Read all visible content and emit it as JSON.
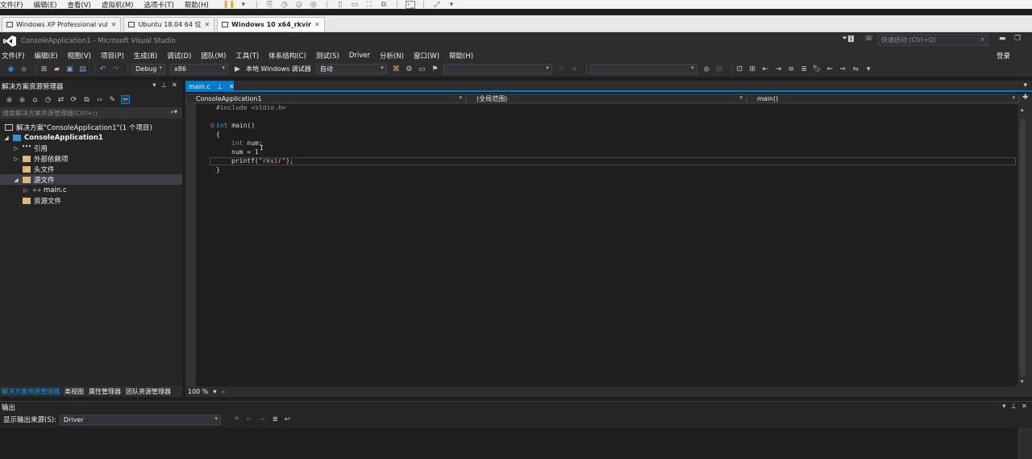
{
  "vmware": {
    "menu": [
      "文件(F)",
      "编辑(E)",
      "查看(V)",
      "虚拟机(M)",
      "选项卡(T)",
      "帮助(H)"
    ],
    "tabs": [
      {
        "label": "Windows XP Professional vul",
        "active": false
      },
      {
        "label": "Ubuntu 18.04 64 位",
        "active": false
      },
      {
        "label": "Windows 10 x64_rkvir",
        "active": true
      }
    ]
  },
  "vs": {
    "title": "ConsoleApplication1 - Microsoft Visual Studio",
    "quick_launch_placeholder": "快速启动 (Ctrl+Q)",
    "notification_count": "1",
    "menu": [
      "文件(F)",
      "编辑(E)",
      "视图(V)",
      "项目(P)",
      "生成(B)",
      "调试(D)",
      "团队(M)",
      "工具(T)",
      "体系结构(C)",
      "测试(S)",
      "Driver",
      "分析(N)",
      "窗口(W)",
      "帮助(H)"
    ],
    "login_label": "登录",
    "toolbar": {
      "config": "Debug",
      "platform": "x86",
      "debug_target": "本地 Windows 调试器",
      "debug_mode": "自动"
    },
    "solution_explorer": {
      "title": "解决方案资源管理器",
      "search_placeholder": "搜索解决方案资源管理器(Ctrl+;)",
      "tree": [
        {
          "label": "解决方案\"ConsoleApplication1\"(1 个项目)",
          "depth": 0,
          "arrow": "",
          "bold": false
        },
        {
          "label": "ConsoleApplication1",
          "depth": 1,
          "arrow": "◢",
          "bold": true
        },
        {
          "label": "引用",
          "depth": 2,
          "arrow": "▷",
          "bold": false
        },
        {
          "label": "外部依赖项",
          "depth": 2,
          "arrow": "▷",
          "bold": false
        },
        {
          "label": "头文件",
          "depth": 2,
          "arrow": "",
          "bold": false
        },
        {
          "label": "源文件",
          "depth": 2,
          "arrow": "◢",
          "bold": false
        },
        {
          "label": "main.c",
          "depth": 3,
          "arrow": "▷",
          "bold": false
        },
        {
          "label": "资源文件",
          "depth": 2,
          "arrow": "",
          "bold": false
        }
      ],
      "bottom_tabs": [
        "解决方案资源管理器",
        "类视图",
        "属性管理器",
        "团队资源管理器"
      ]
    },
    "editor": {
      "tab_label": "main.c",
      "nav_project": "ConsoleApplication1",
      "nav_scope": "(全局范围)",
      "nav_member": "main()",
      "zoom": "100 %",
      "code": {
        "include": "#include <stdio.h>",
        "main_kw": "int",
        "main_rest": " main()",
        "open_brace": "{",
        "decl_kw": "int",
        "decl_rest": " num;",
        "assign": "num = 1",
        "printf_fn": "printf(",
        "printf_str": "\"rkvir\"",
        "printf_end": ");",
        "close_brace": "}"
      }
    },
    "output": {
      "title": "输出",
      "source_label": "显示输出来源(S):",
      "source_value": "Driver"
    }
  }
}
